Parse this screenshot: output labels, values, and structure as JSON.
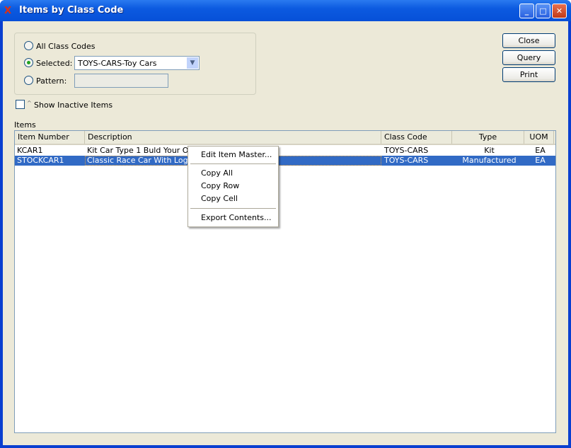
{
  "window": {
    "title": "Items by Class Code",
    "logo": "X",
    "minimize": "_",
    "maximize": "□",
    "close": "✕"
  },
  "filter": {
    "all_label": "All Class Codes",
    "selected_label": "Selected:",
    "selected_value": "TOYS-CARS-Toy Cars",
    "pattern_label": "Pattern:",
    "pattern_value": "",
    "mode": "selected"
  },
  "show_inactive": {
    "label": "Show Inactive Items",
    "checked": false
  },
  "buttons": {
    "close": "Close",
    "query": "Query",
    "print": "Print"
  },
  "items": {
    "label": "Items",
    "columns": [
      "Item Number",
      "Description",
      "Class Code",
      "Type",
      "UOM"
    ],
    "rows": [
      {
        "item": "KCAR1",
        "desc": "Kit Car Type 1 Buld Your Own",
        "class": "TOYS-CARS",
        "type": "Kit",
        "uom": "EA"
      },
      {
        "item": "STOCKCAR1",
        "desc": "Classic Race Car With Logo Car",
        "class": "TOYS-CARS",
        "type": "Manufactured",
        "uom": "EA"
      }
    ],
    "selected_row": 1
  },
  "context_menu": {
    "edit": "Edit Item Master...",
    "copy_all": "Copy All",
    "copy_row": "Copy Row",
    "copy_cell": "Copy Cell",
    "export": "Export Contents..."
  }
}
